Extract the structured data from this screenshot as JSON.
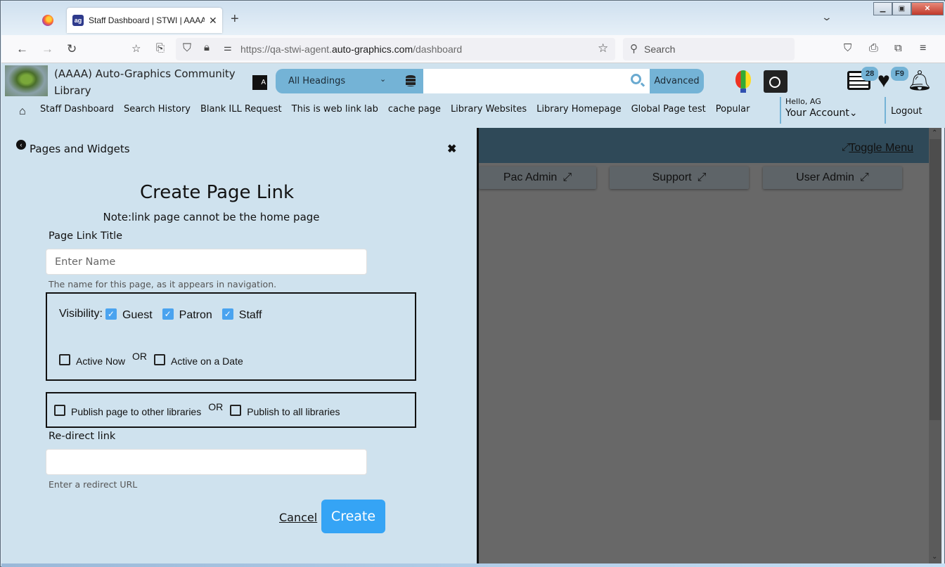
{
  "browser": {
    "tab_title": "Staff Dashboard | STWI | AAAA |",
    "tab_favicon": "ag",
    "url_prefix": "https://qa-stwi-agent.",
    "url_domain": "auto-graphics.com",
    "url_path": "/dashboard",
    "search_placeholder": "Search",
    "icons": [
      "back-icon",
      "forward-icon",
      "reload-icon",
      "bookmark-star-icon",
      "share-icon",
      "shield-icon",
      "lock-icon",
      "permissions-icon",
      "star-icon",
      "pocket-icon",
      "print-icon",
      "extensions-icon",
      "menu-icon"
    ]
  },
  "header": {
    "library_name": "(AAAA) Auto-Graphics Community Library",
    "search_scope": "All Headings",
    "search_value": "",
    "advanced_label": "Advanced",
    "list_badge": "28",
    "favorites_badge": "F9",
    "nav_links": [
      "Staff Dashboard",
      "Search History",
      "Blank ILL Request",
      "This is web link lab",
      "cache page",
      "Library Websites",
      "Library Homepage",
      "Global Page test",
      "Popular"
    ],
    "greeting": "Hello, AG",
    "account_label": "Your Account",
    "logout_label": "Logout"
  },
  "panel": {
    "title": "Pages and Widgets",
    "form_title": "Create Page Link",
    "note": "Note:link page cannot be the home page",
    "page_link_title_label": "Page Link Title",
    "page_link_title_placeholder": "Enter Name",
    "page_link_title_value": "",
    "page_link_title_help": "The name for this page, as it appears in navigation.",
    "visibility_label": "Visibility:",
    "visibility": [
      {
        "label": "Guest",
        "checked": true
      },
      {
        "label": "Patron",
        "checked": true
      },
      {
        "label": "Staff",
        "checked": true
      }
    ],
    "active_now_label": "Active Now",
    "active_now_checked": false,
    "or_label": "OR",
    "active_date_label": "Active on a Date",
    "active_date_checked": false,
    "publish_other_label": "Publish page to other libraries",
    "publish_other_checked": false,
    "publish_all_label": "Publish to all libraries",
    "publish_all_checked": false,
    "redirect_label": "Re-direct link",
    "redirect_value": "",
    "redirect_help": "Enter a redirect URL",
    "cancel_label": "Cancel",
    "create_label": "Create"
  },
  "dashboard": {
    "toggle_menu_label": "Toggle Menu",
    "cards": [
      "Pac Admin",
      "Support",
      "User Admin"
    ]
  }
}
